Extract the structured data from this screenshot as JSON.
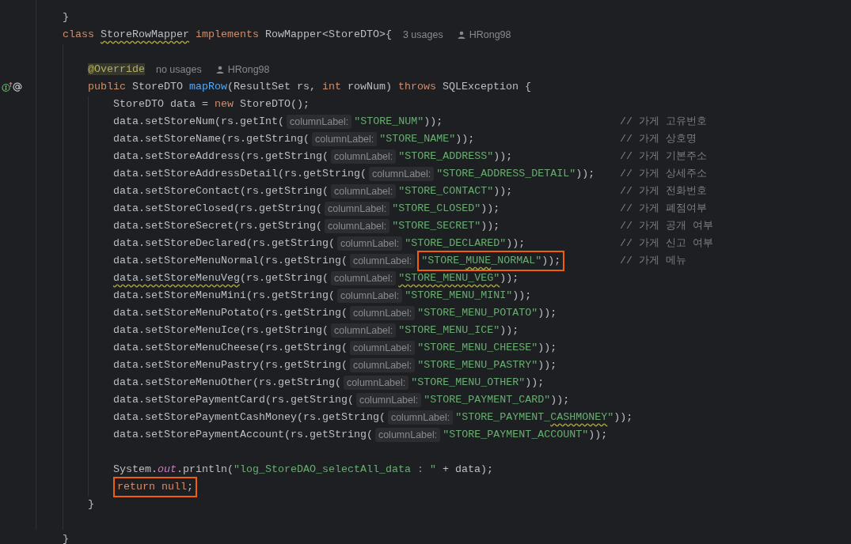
{
  "editor": {
    "lines": [
      {
        "kind": "code",
        "tokens": [
          {
            "kind": "txt",
            "text": "    }"
          }
        ]
      },
      {
        "kind": "code",
        "tokens": [
          {
            "kind": "kw",
            "text": "    class "
          },
          {
            "kind": "warn",
            "text": "StoreRowMapper"
          },
          {
            "kind": "kw",
            "text": " implements"
          },
          {
            "kind": "txt",
            "text": " RowMapper<StoreDTO>{"
          },
          {
            "kind": "usages",
            "text": "3 usages"
          },
          {
            "kind": "author",
            "text": "HRong98"
          }
        ]
      },
      {
        "kind": "blank"
      },
      {
        "kind": "code",
        "tokens": [
          {
            "kind": "ann",
            "text": "        @Override"
          },
          {
            "kind": "usages",
            "text": "no usages"
          },
          {
            "kind": "author",
            "text": "HRong98"
          }
        ]
      },
      {
        "kind": "code",
        "gutter_icons": [
          {
            "kind": "implements"
          },
          {
            "kind": "annotation"
          }
        ],
        "tokens": [
          {
            "kind": "kw",
            "text": "        public"
          },
          {
            "kind": "txt",
            "text": " StoreDTO "
          },
          {
            "kind": "fn",
            "text": "mapRow"
          },
          {
            "kind": "txt",
            "text": "(ResultSet rs, "
          },
          {
            "kind": "kw",
            "text": "int"
          },
          {
            "kind": "txt",
            "text": " rowNum) "
          },
          {
            "kind": "kw",
            "text": "throws"
          },
          {
            "kind": "txt",
            "text": " SQLException {"
          }
        ]
      },
      {
        "kind": "code",
        "tokens": [
          {
            "kind": "txt",
            "text": "            StoreDTO data = "
          },
          {
            "kind": "kw",
            "text": "new"
          },
          {
            "kind": "txt",
            "text": " StoreDTO();"
          }
        ]
      },
      {
        "kind": "code",
        "tokens": [
          {
            "kind": "txt",
            "text": "            data.setStoreNum(rs.getInt("
          },
          {
            "kind": "hint",
            "text": "columnLabel:"
          },
          {
            "kind": "str",
            "text": "\"STORE_NUM\""
          },
          {
            "kind": "txt",
            "text": "));"
          },
          {
            "kind": "note",
            "text": "// 가게 고유번호"
          }
        ]
      },
      {
        "kind": "code",
        "tokens": [
          {
            "kind": "txt",
            "text": "            data.setStoreName(rs.getString("
          },
          {
            "kind": "hint",
            "text": "columnLabel:"
          },
          {
            "kind": "str",
            "text": "\"STORE_NAME\""
          },
          {
            "kind": "txt",
            "text": "));"
          },
          {
            "kind": "note",
            "text": "// 가게 상호명"
          }
        ]
      },
      {
        "kind": "code",
        "tokens": [
          {
            "kind": "txt",
            "text": "            data.setStoreAddress(rs.getString("
          },
          {
            "kind": "hint",
            "text": "columnLabel:"
          },
          {
            "kind": "str",
            "text": "\"STORE_ADDRESS\""
          },
          {
            "kind": "txt",
            "text": "));"
          },
          {
            "kind": "note",
            "text": "// 가게 기본주소"
          }
        ]
      },
      {
        "kind": "code",
        "tokens": [
          {
            "kind": "txt",
            "text": "            data.setStoreAddressDetail(rs.getString("
          },
          {
            "kind": "hint",
            "text": "columnLabel:"
          },
          {
            "kind": "str",
            "text": "\"STORE_ADDRESS_DETAIL\""
          },
          {
            "kind": "txt",
            "text": "));"
          },
          {
            "kind": "note",
            "text": "// 가게 상세주소"
          }
        ]
      },
      {
        "kind": "code",
        "tokens": [
          {
            "kind": "txt",
            "text": "            data.setStoreContact(rs.getString("
          },
          {
            "kind": "hint",
            "text": "columnLabel:"
          },
          {
            "kind": "str",
            "text": "\"STORE_CONTACT\""
          },
          {
            "kind": "txt",
            "text": "));"
          },
          {
            "kind": "note",
            "text": "// 가게 전화번호"
          }
        ]
      },
      {
        "kind": "code",
        "tokens": [
          {
            "kind": "txt",
            "text": "            data.setStoreClosed(rs.getString("
          },
          {
            "kind": "hint",
            "text": "columnLabel:"
          },
          {
            "kind": "str",
            "text": "\"STORE_CLOSED\""
          },
          {
            "kind": "txt",
            "text": "));"
          },
          {
            "kind": "note",
            "text": "// 가게 폐점여부"
          }
        ]
      },
      {
        "kind": "code",
        "tokens": [
          {
            "kind": "txt",
            "text": "            data.setStoreSecret(rs.getString("
          },
          {
            "kind": "hint",
            "text": "columnLabel:"
          },
          {
            "kind": "str",
            "text": "\"STORE_SECRET\""
          },
          {
            "kind": "txt",
            "text": "));"
          },
          {
            "kind": "note",
            "text": "// 가게 공개 여부"
          }
        ]
      },
      {
        "kind": "code",
        "tokens": [
          {
            "kind": "txt",
            "text": "            data.setStoreDeclared(rs.getString("
          },
          {
            "kind": "hint",
            "text": "columnLabel:"
          },
          {
            "kind": "str",
            "text": "\"STORE_DECLARED\""
          },
          {
            "kind": "txt",
            "text": "));"
          },
          {
            "kind": "note",
            "text": "// 가게 신고 여부"
          }
        ]
      },
      {
        "kind": "code",
        "tokens": [
          {
            "kind": "txt",
            "text": "            data.setStoreMenuNormal(rs.getString("
          },
          {
            "kind": "hint",
            "text": "columnLabel:"
          },
          {
            "kind": "box",
            "tokens": [
              {
                "kind": "str",
                "text": "\"STORE_"
              },
              {
                "kind": "strwarn",
                "text": "MUNE"
              },
              {
                "kind": "str",
                "text": "_NORMAL\""
              },
              {
                "kind": "txt",
                "text": "));"
              }
            ]
          },
          {
            "kind": "note",
            "text": "// 가게 메뉴"
          }
        ]
      },
      {
        "kind": "code",
        "tokens": [
          {
            "kind": "warn",
            "text": "            data.setStoreMenuVeg"
          },
          {
            "kind": "txt",
            "text": "(rs.getString("
          },
          {
            "kind": "hint",
            "text": "columnLabel:"
          },
          {
            "kind": "strwarn",
            "text": "\"STORE_MENU_VEG\""
          },
          {
            "kind": "txt",
            "text": "));"
          }
        ]
      },
      {
        "kind": "code",
        "tokens": [
          {
            "kind": "txt",
            "text": "            data.setStoreMenuMini(rs.getString("
          },
          {
            "kind": "hint",
            "text": "columnLabel:"
          },
          {
            "kind": "str",
            "text": "\"STORE_MENU_MINI\""
          },
          {
            "kind": "txt",
            "text": "));"
          }
        ]
      },
      {
        "kind": "code",
        "tokens": [
          {
            "kind": "txt",
            "text": "            data.setStoreMenuPotato(rs.getString("
          },
          {
            "kind": "hint",
            "text": "columnLabel:"
          },
          {
            "kind": "str",
            "text": "\"STORE_MENU_POTATO\""
          },
          {
            "kind": "txt",
            "text": "));"
          }
        ]
      },
      {
        "kind": "code",
        "tokens": [
          {
            "kind": "txt",
            "text": "            data.setStoreMenuIce(rs.getString("
          },
          {
            "kind": "hint",
            "text": "columnLabel:"
          },
          {
            "kind": "str",
            "text": "\"STORE_MENU_ICE\""
          },
          {
            "kind": "txt",
            "text": "));"
          }
        ]
      },
      {
        "kind": "code",
        "tokens": [
          {
            "kind": "txt",
            "text": "            data.setStoreMenuCheese(rs.getString("
          },
          {
            "kind": "hint",
            "text": "columnLabel:"
          },
          {
            "kind": "str",
            "text": "\"STORE_MENU_CHEESE\""
          },
          {
            "kind": "txt",
            "text": "));"
          }
        ]
      },
      {
        "kind": "code",
        "tokens": [
          {
            "kind": "txt",
            "text": "            data.setStoreMenuPastry(rs.getString("
          },
          {
            "kind": "hint",
            "text": "columnLabel:"
          },
          {
            "kind": "str",
            "text": "\"STORE_MENU_PASTRY\""
          },
          {
            "kind": "txt",
            "text": "));"
          }
        ]
      },
      {
        "kind": "code",
        "tokens": [
          {
            "kind": "txt",
            "text": "            data.setStoreMenuOther(rs.getString("
          },
          {
            "kind": "hint",
            "text": "columnLabel:"
          },
          {
            "kind": "str",
            "text": "\"STORE_MENU_OTHER\""
          },
          {
            "kind": "txt",
            "text": "));"
          }
        ]
      },
      {
        "kind": "code",
        "tokens": [
          {
            "kind": "txt",
            "text": "            data.setStorePaymentCard(rs.getString("
          },
          {
            "kind": "hint",
            "text": "columnLabel:"
          },
          {
            "kind": "str",
            "text": "\"STORE_PAYMENT_CARD\""
          },
          {
            "kind": "txt",
            "text": "));"
          }
        ]
      },
      {
        "kind": "code",
        "tokens": [
          {
            "kind": "txt",
            "text": "            data.setStorePaymentCashMoney(rs.getString("
          },
          {
            "kind": "hint",
            "text": "columnLabel:"
          },
          {
            "kind": "str",
            "text": "\"STORE_PAYMENT_"
          },
          {
            "kind": "strwarn",
            "text": "CASHMONEY"
          },
          {
            "kind": "str",
            "text": "\""
          },
          {
            "kind": "txt",
            "text": "));"
          }
        ]
      },
      {
        "kind": "code",
        "tokens": [
          {
            "kind": "txt",
            "text": "            data.setStorePaymentAccount(rs.getString("
          },
          {
            "kind": "hint",
            "text": "columnLabel:"
          },
          {
            "kind": "str",
            "text": "\"STORE_PAYMENT_ACCOUNT\""
          },
          {
            "kind": "txt",
            "text": "));"
          }
        ]
      },
      {
        "kind": "blank"
      },
      {
        "kind": "code",
        "tokens": [
          {
            "kind": "txt",
            "text": "            System."
          },
          {
            "kind": "static",
            "text": "out"
          },
          {
            "kind": "txt",
            "text": ".println("
          },
          {
            "kind": "str",
            "text": "\"log_StoreDAO_selectAll_data : \""
          },
          {
            "kind": "txt",
            "text": " + data);"
          }
        ]
      },
      {
        "kind": "code",
        "tokens": [
          {
            "kind": "box",
            "tokens": [
              {
                "kind": "kw",
                "text": "            return null"
              },
              {
                "kind": "txt",
                "text": ";"
              }
            ]
          }
        ]
      },
      {
        "kind": "code",
        "tokens": [
          {
            "kind": "txt",
            "text": "        }"
          }
        ]
      },
      {
        "kind": "blank"
      },
      {
        "kind": "code",
        "tokens": [
          {
            "kind": "txt",
            "text": "    }"
          }
        ]
      }
    ]
  }
}
